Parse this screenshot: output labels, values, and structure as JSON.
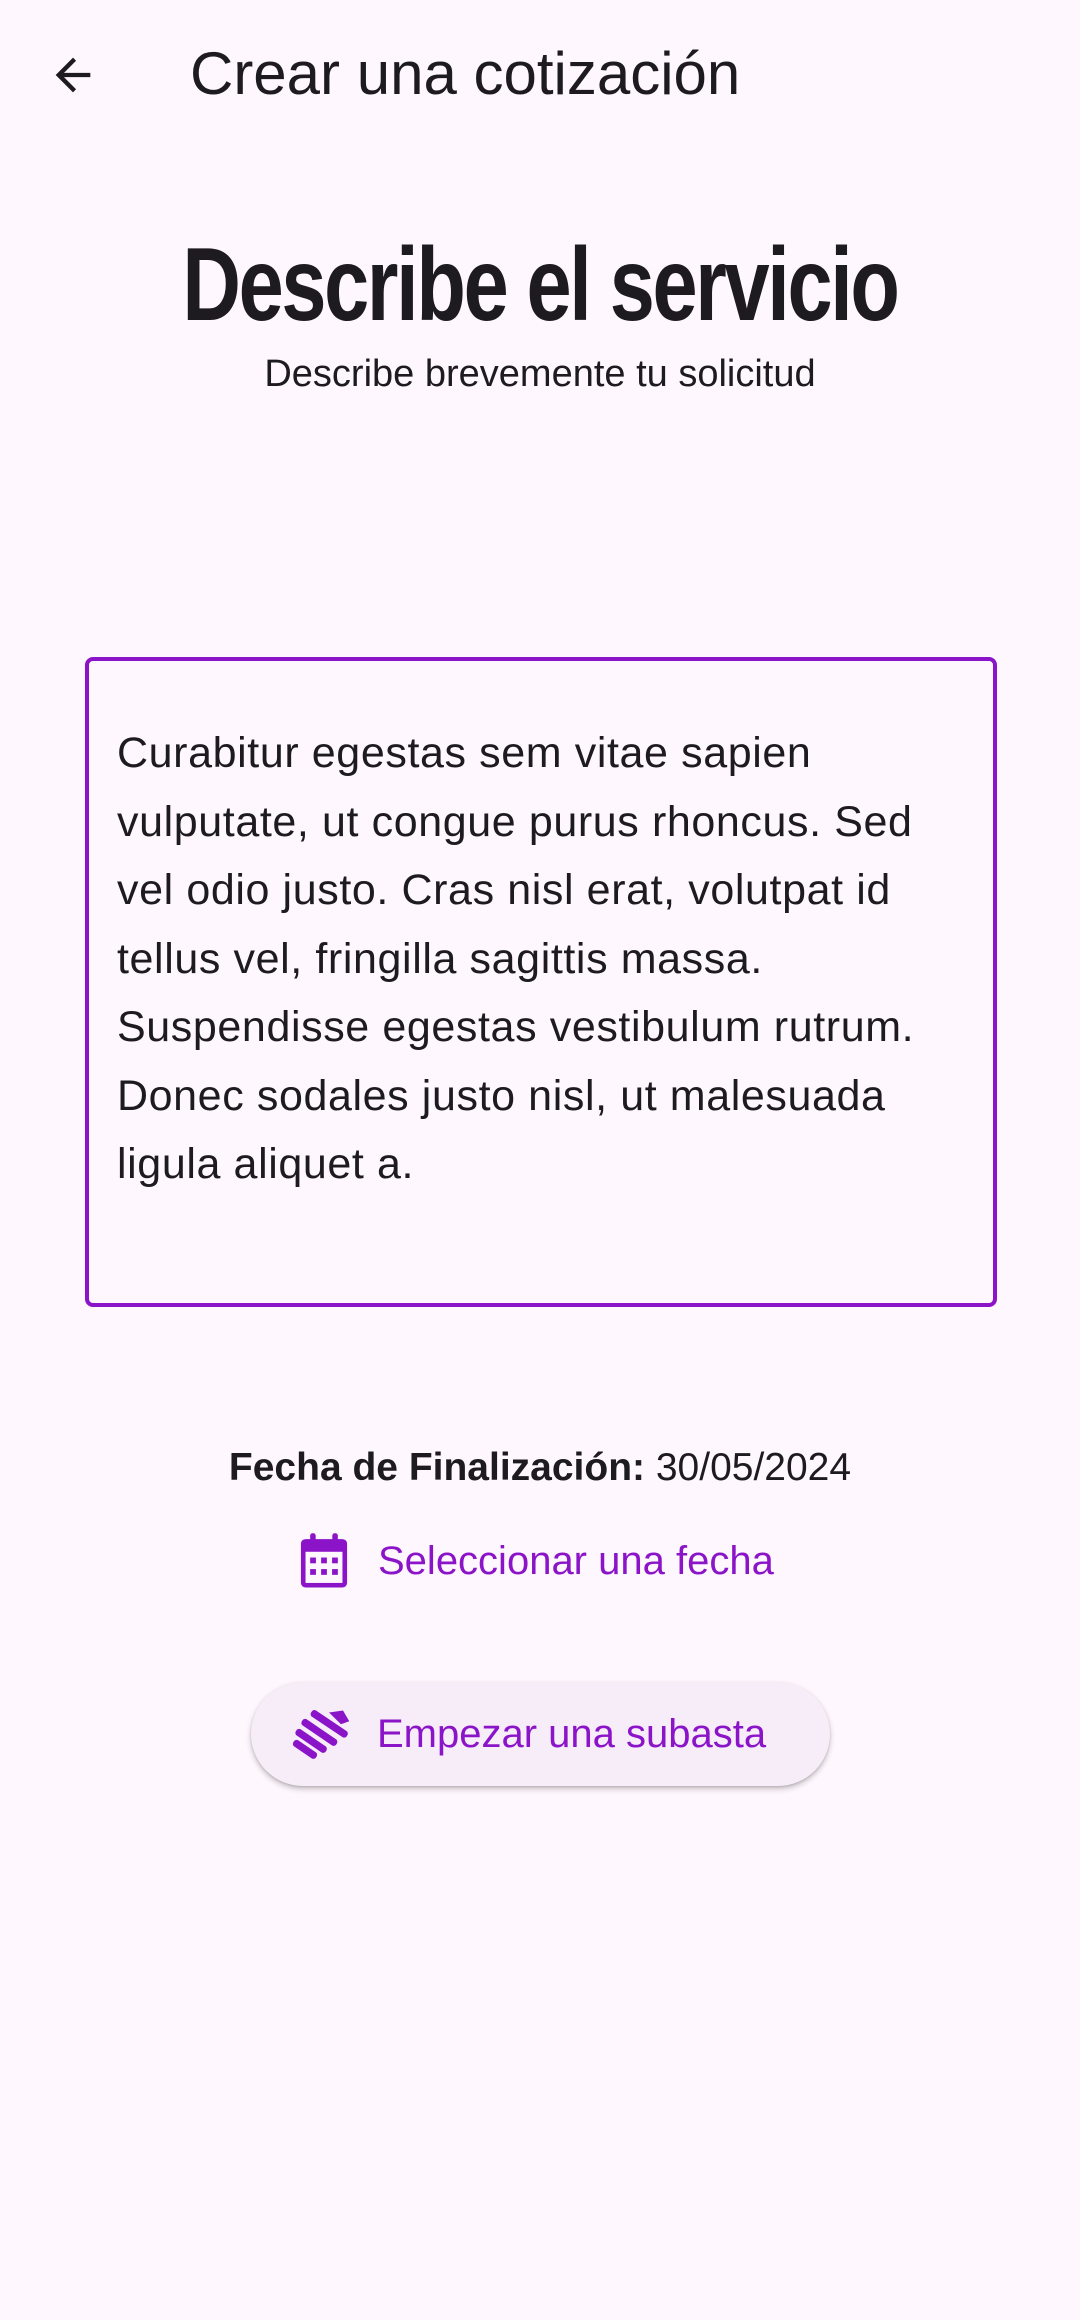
{
  "colors": {
    "accent": "#8B14C9",
    "background": "#FEF7FD",
    "text": "#1D1B20",
    "button_bg": "#F6EDF8"
  },
  "appbar": {
    "back_icon": "arrow-back-icon",
    "title": "Crear una cotización"
  },
  "main": {
    "heading": "Describe el servicio",
    "subheading": "Describe brevemente tu solicitud",
    "description_value": "Curabitur egestas sem vitae sapien vulputate, ut congue purus rhoncus. Sed vel odio justo. Cras nisl erat, volutpat id tellus vel, fringilla sagittis massa. Suspendisse egestas vestibulum rutrum. Donec sodales justo nisl, ut malesuada ligula aliquet a."
  },
  "date": {
    "label": "Fecha de Finalización:",
    "value": "30/05/2024",
    "select_icon": "calendar-icon",
    "select_label": "Seleccionar una fecha"
  },
  "actions": {
    "auction_icon": "handshake-icon",
    "auction_label": "Empezar una subasta"
  }
}
